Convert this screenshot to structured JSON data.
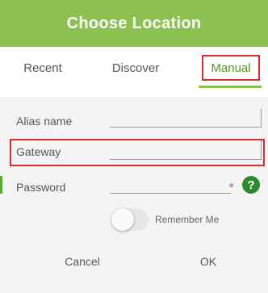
{
  "dialog": {
    "title": "Choose Location",
    "tabs": [
      {
        "label": "Recent"
      },
      {
        "label": "Discover"
      },
      {
        "label": "Manual"
      }
    ],
    "active_tab": "Manual"
  },
  "form": {
    "alias": {
      "label": "Alias name",
      "value": ""
    },
    "gateway": {
      "label": "Gateway",
      "value": ""
    },
    "password": {
      "label": "Password",
      "value": ""
    },
    "remember_label": "Remember Me"
  },
  "buttons": {
    "cancel": "Cancel",
    "ok": "OK"
  },
  "colors": {
    "accent": "#8cc152",
    "highlight": "#e12a2a",
    "help": "#2f8a2f"
  },
  "icons": {
    "help": "question-icon",
    "visibility": "lock-icon"
  }
}
